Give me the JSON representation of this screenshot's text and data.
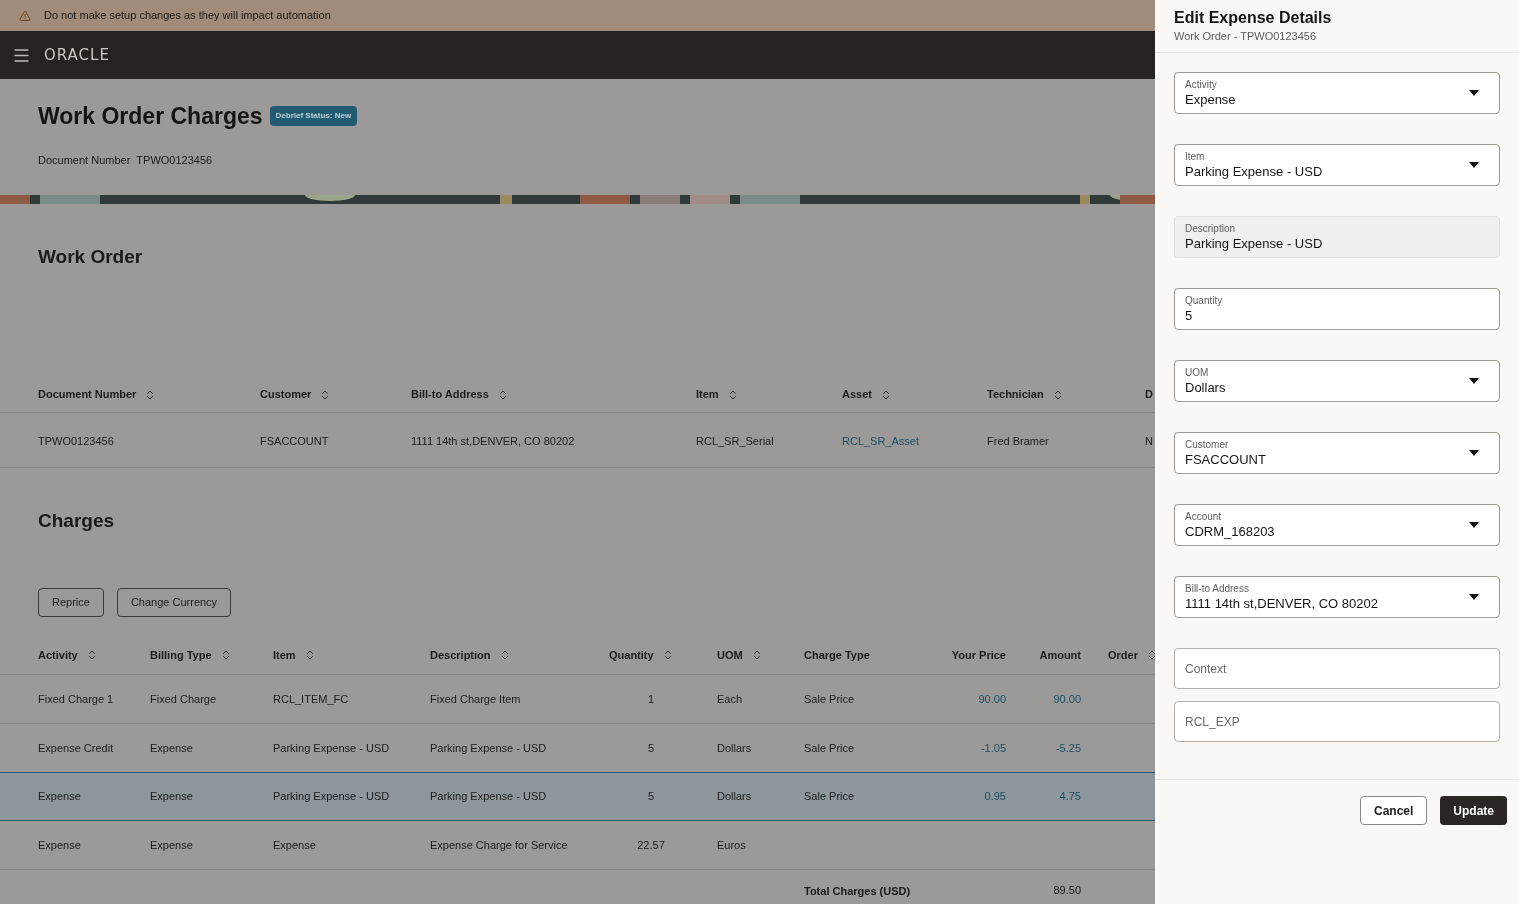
{
  "banner": {
    "text": "Do not make setup changes as they will impact automation"
  },
  "header": {
    "logo": "ORACLE"
  },
  "page": {
    "title": "Work Order Charges",
    "status_badge": "Debrief Status: New",
    "document_label": "Document Number",
    "document_number": "TPWO0123456"
  },
  "work_order": {
    "title": "Work Order",
    "columns": [
      {
        "label": "Document Number",
        "sortable": true
      },
      {
        "label": "Customer",
        "sortable": true
      },
      {
        "label": "Bill-to Address",
        "sortable": true
      },
      {
        "label": "Item",
        "sortable": true
      },
      {
        "label": "Asset",
        "sortable": true
      },
      {
        "label": "Technician",
        "sortable": true
      },
      {
        "label": "D",
        "sortable": false
      }
    ],
    "rows": [
      [
        {
          "text": "TPWO0123456",
          "link": false
        },
        {
          "text": "FSACCOUNT",
          "link": false
        },
        {
          "text": "1111 14th st,DENVER, CO 80202",
          "link": false
        },
        {
          "text": "RCL_SR_Serial",
          "link": false
        },
        {
          "text": "RCL_SR_Asset",
          "link": true
        },
        {
          "text": "Fred Bramer",
          "link": false
        },
        {
          "text": "N",
          "link": false
        }
      ]
    ]
  },
  "charges": {
    "title": "Charges",
    "buttons": [
      "Reprice",
      "Change Currency"
    ],
    "columns": [
      {
        "label": "Activity",
        "sortable": true,
        "kind": "text"
      },
      {
        "label": "Billing Type",
        "sortable": true,
        "kind": "text"
      },
      {
        "label": "Item",
        "sortable": true,
        "kind": "text"
      },
      {
        "label": "Description",
        "sortable": true,
        "kind": "text"
      },
      {
        "label": "Quantity",
        "sortable": true,
        "kind": "number"
      },
      {
        "label": "UOM",
        "sortable": true,
        "kind": "text"
      },
      {
        "label": "Charge Type",
        "sortable": false,
        "kind": "text"
      },
      {
        "label": "Your Price",
        "sortable": false,
        "kind": "price"
      },
      {
        "label": "Amount",
        "sortable": false,
        "kind": "price"
      },
      {
        "label": "Order",
        "sortable": true,
        "kind": "text"
      }
    ],
    "rows": [
      {
        "selected": false,
        "cells": [
          "Fixed Charge 1",
          "Fixed Charge",
          "RCL_ITEM_FC",
          "Fixed Charge Item",
          "1",
          "Each",
          "Sale Price",
          "90.00",
          "90.00"
        ]
      },
      {
        "selected": false,
        "cells": [
          "Expense Credit",
          "Expense",
          "Parking Expense - USD",
          "Parking Expense - USD",
          "5",
          "Dollars",
          "Sale Price",
          "-1.05",
          "-5.25"
        ]
      },
      {
        "selected": true,
        "cells": [
          "Expense",
          "Expense",
          "Parking Expense - USD",
          "Parking Expense - USD",
          "5",
          "Dollars",
          "Sale Price",
          "0.95",
          "4.75"
        ]
      },
      {
        "selected": false,
        "cells": [
          "Expense",
          "Expense",
          "Expense",
          "Expense Charge for Service",
          "22.57",
          "Euros"
        ]
      }
    ],
    "total": {
      "label": "Total Charges (USD)",
      "value": "89.50"
    }
  },
  "drawer": {
    "title": "Edit Expense Details",
    "subtitle": "Work Order - TPWO0123456",
    "fields": [
      {
        "kind": "select",
        "label": "Activity",
        "value": "Expense"
      },
      {
        "kind": "select",
        "label": "Item",
        "value": "Parking Expense - USD"
      },
      {
        "kind": "readonly",
        "label": "Description",
        "value": "Parking Expense - USD"
      },
      {
        "kind": "text",
        "label": "Quantity",
        "value": "5"
      },
      {
        "kind": "select",
        "label": "UOM",
        "value": "Dollars"
      },
      {
        "kind": "select",
        "label": "Customer",
        "value": "FSACCOUNT"
      },
      {
        "kind": "select",
        "label": "Account",
        "value": "CDRM_168203"
      },
      {
        "kind": "select",
        "label": "Bill-to Address",
        "value": "1111 14th st,DENVER, CO 80202"
      },
      {
        "kind": "empty",
        "placeholder": "Context"
      },
      {
        "kind": "empty",
        "placeholder": "RCL_EXP"
      }
    ],
    "buttons": [
      {
        "label": "Cancel",
        "primary": false
      },
      {
        "label": "Update",
        "primary": true
      }
    ]
  }
}
